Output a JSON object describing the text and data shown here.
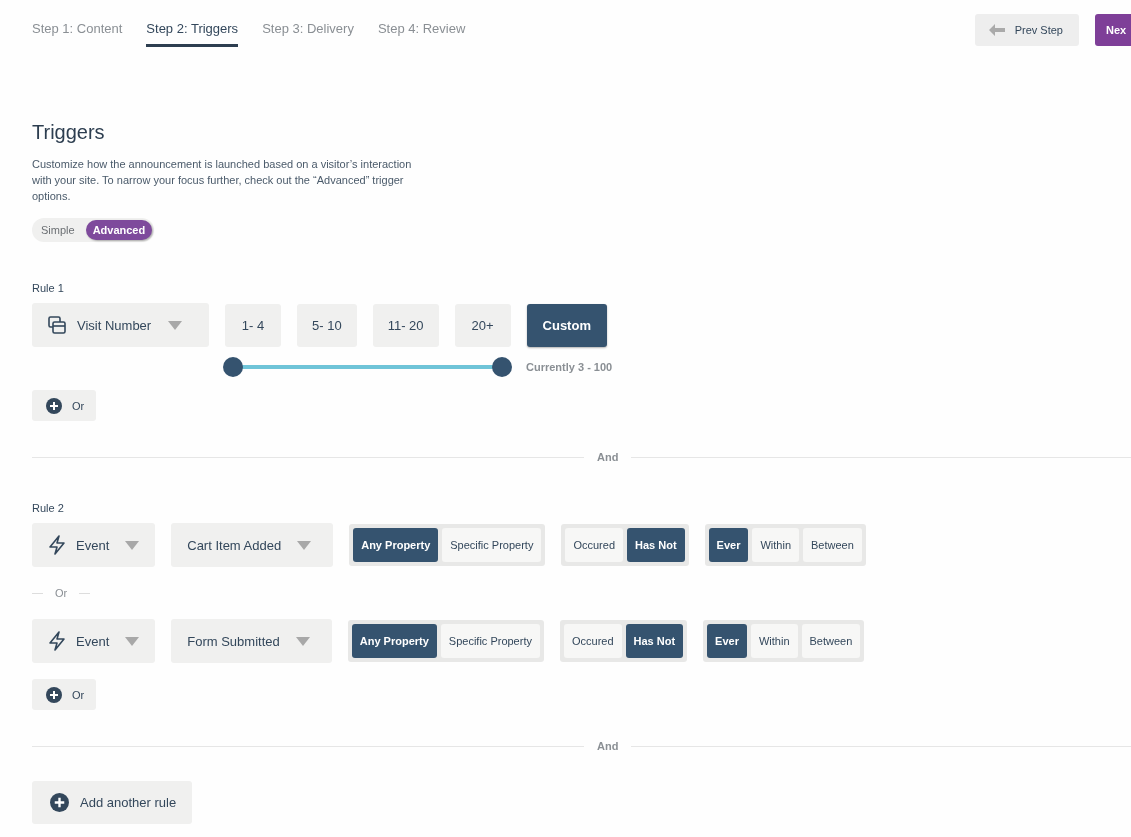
{
  "steps": [
    {
      "label": "Step 1: Content",
      "selected": false
    },
    {
      "label": "Step 2: Triggers",
      "selected": true
    },
    {
      "label": "Step 3: Delivery",
      "selected": false
    },
    {
      "label": "Step 4: Review",
      "selected": false
    }
  ],
  "prev_button": "Prev Step",
  "next_button": "Nex",
  "title": "Triggers",
  "description": "Customize how the announcement is launched based on a visitor’s interaction with your site. To narrow your focus further, check out the “Advanced” trigger options.",
  "mode_toggle": [
    {
      "label": "Simple",
      "selected": false
    },
    {
      "label": "Advanced",
      "selected": true
    }
  ],
  "rules": [
    {
      "label": "Rule 1",
      "conditions": [
        {
          "kind": "visit",
          "type": "Visit Number",
          "presets": [
            {
              "label": "1- 4",
              "selected": false
            },
            {
              "label": "5- 10",
              "selected": false
            },
            {
              "label": "11- 20",
              "selected": false
            },
            {
              "label": "20+",
              "selected": false
            },
            {
              "label": "Custom",
              "selected": true
            }
          ],
          "range": {
            "level": 1,
            "reading": "Currently 3 - 100"
          }
        }
      ],
      "or_button": "Or",
      "separator": "And"
    },
    {
      "label": "Rule 2",
      "conditions": [
        {
          "kind": "event",
          "type": "Event",
          "event": "Cart Item Added",
          "groups": [
            [
              {
                "label": "Any Property",
                "selected": true
              },
              {
                "label": "Specific Property",
                "selected": false
              }
            ],
            [
              {
                "label": "Occured",
                "selected": false
              },
              {
                "label": "Has Not",
                "selected": true
              }
            ],
            [
              {
                "label": "Ever",
                "selected": true
              },
              {
                "label": "Within",
                "selected": false
              },
              {
                "label": "Between",
                "selected": false
              }
            ]
          ]
        },
        {
          "kind": "event",
          "type": "Event",
          "event": "Form Submitted",
          "groups": [
            [
              {
                "label": "Any Property",
                "selected": true
              },
              {
                "label": "Specific Property",
                "selected": false
              }
            ],
            [
              {
                "label": "Occured",
                "selected": false
              },
              {
                "label": "Has Not",
                "selected": true
              }
            ],
            [
              {
                "label": "Ever",
                "selected": true
              },
              {
                "label": "Within",
                "selected": false
              },
              {
                "label": "Between",
                "selected": false
              }
            ]
          ]
        }
      ],
      "condition_separator": "Or",
      "or_button": "Or",
      "separator": "And"
    }
  ],
  "add_rule_button": "Add another rule"
}
